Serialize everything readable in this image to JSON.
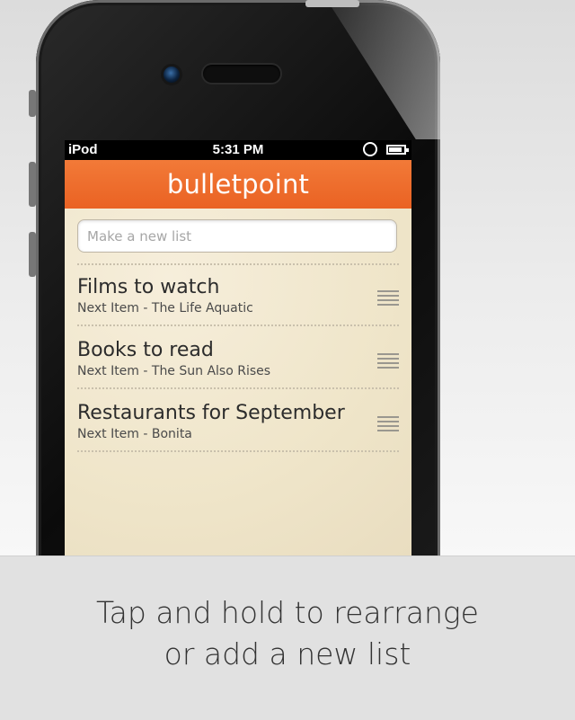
{
  "status_bar": {
    "carrier": "iPod",
    "time": "5:31 PM"
  },
  "app": {
    "title": "bulletpoint",
    "accent_color": "#ec6a2a"
  },
  "new_list": {
    "placeholder": "Make a new list"
  },
  "lists": [
    {
      "title": "Films to watch",
      "next_item": "Next Item - The Life Aquatic"
    },
    {
      "title": "Books to read",
      "next_item": "Next Item - The Sun Also Rises"
    },
    {
      "title": "Restaurants for September",
      "next_item": "Next Item - Bonita"
    }
  ],
  "caption": {
    "line1": "Tap and hold to rearrange",
    "line2": "or add a new list"
  }
}
